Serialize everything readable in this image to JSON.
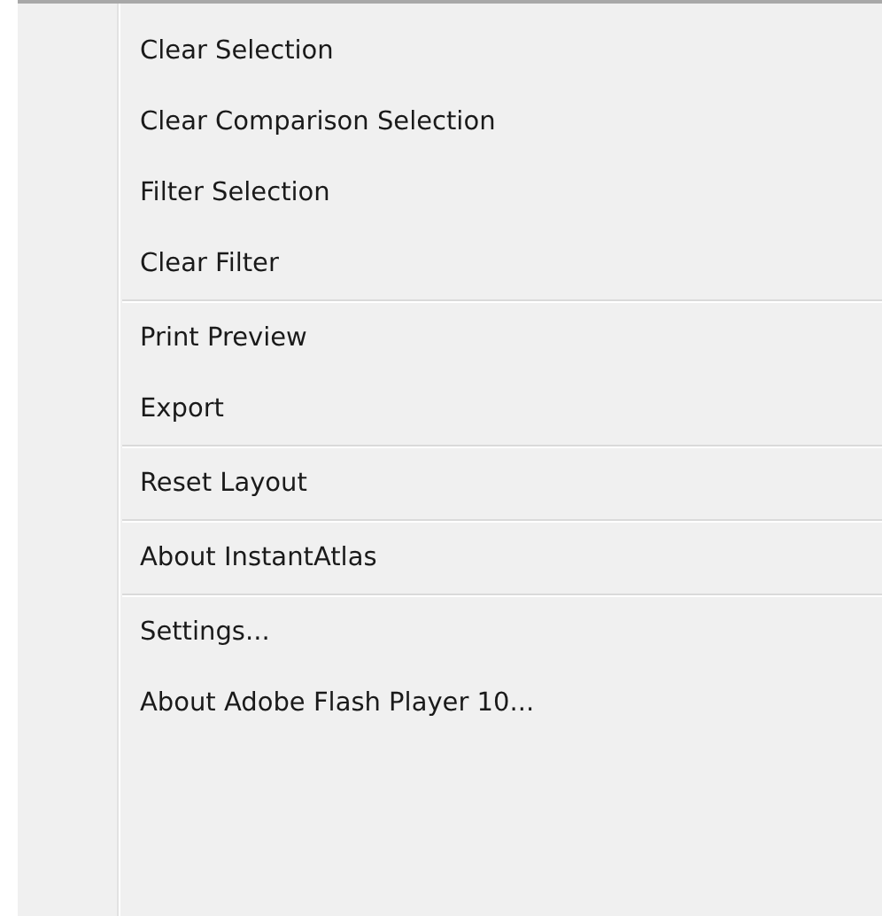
{
  "context_menu": {
    "groups": [
      {
        "items": [
          "Clear Selection",
          "Clear Comparison Selection",
          "Filter Selection",
          "Clear Filter"
        ]
      },
      {
        "items": [
          "Print Preview",
          "Export"
        ]
      },
      {
        "items": [
          "Reset Layout"
        ]
      },
      {
        "items": [
          "About InstantAtlas"
        ]
      },
      {
        "items": [
          "Settings...",
          "About Adobe Flash Player 10..."
        ]
      }
    ]
  }
}
